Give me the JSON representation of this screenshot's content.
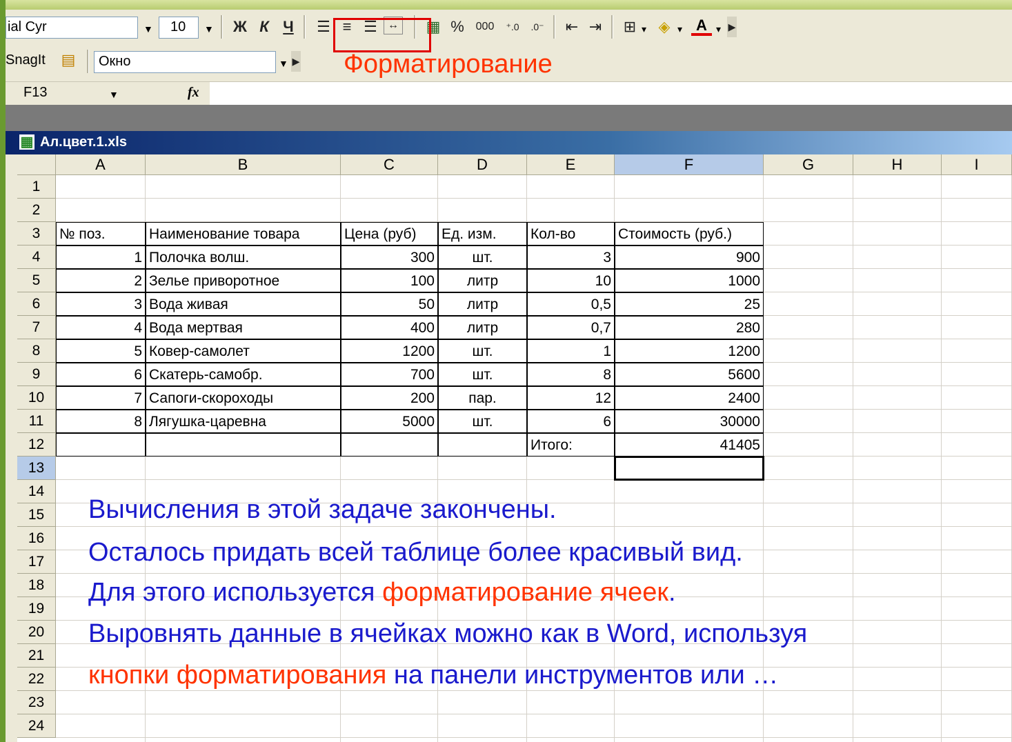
{
  "toolbar": {
    "font_name": "ial Cyr",
    "font_size": "10",
    "bold_label": "Ж",
    "italic_label": "К",
    "underline_label": "Ч",
    "percent_label": "%",
    "thousands_label": "000",
    "snagit_label": "SnagIt",
    "window_label": "Окно",
    "formatting_caption": "Форматирование"
  },
  "formula_bar": {
    "name_box": "F13",
    "fx_label": "fx"
  },
  "window": {
    "title": "Ал.цвет.1.xls"
  },
  "columns": [
    "A",
    "B",
    "C",
    "D",
    "E",
    "F",
    "G",
    "H",
    "I"
  ],
  "selected_column": "F",
  "selected_row": "13",
  "rows": [
    "1",
    "2",
    "3",
    "4",
    "5",
    "6",
    "7",
    "8",
    "9",
    "10",
    "11",
    "12",
    "13",
    "14",
    "15",
    "16",
    "17",
    "18",
    "19",
    "20",
    "21",
    "22",
    "23",
    "24"
  ],
  "table": {
    "headers": [
      "№ поз.",
      "Наименование товара",
      "Цена (руб)",
      "Ед. изм.",
      "Кол-во",
      "Стоимость (руб.)"
    ],
    "items": [
      [
        "1",
        "Полочка волш.",
        "300",
        "шт.",
        "3",
        "900"
      ],
      [
        "2",
        "Зелье приворотное",
        "100",
        "литр",
        "10",
        "1000"
      ],
      [
        "3",
        "Вода живая",
        "50",
        "литр",
        "0,5",
        "25"
      ],
      [
        "4",
        "Вода мертвая",
        "400",
        "литр",
        "0,7",
        "280"
      ],
      [
        "5",
        "Ковер-самолет",
        "1200",
        "шт.",
        "1",
        "1200"
      ],
      [
        "6",
        "Скатерь-самобр.",
        "700",
        "шт.",
        "8",
        "5600"
      ],
      [
        "7",
        "Сапоги-скороходы",
        "200",
        "пар.",
        "12",
        "2400"
      ],
      [
        "8",
        "Лягушка-царевна",
        "5000",
        "шт.",
        "6",
        "30000"
      ]
    ],
    "total_label": "Итого:",
    "total_value": "41405"
  },
  "notes": {
    "line1": "Вычисления в этой задаче закончены.",
    "line2": "Осталось придать всей таблице более красивый вид.",
    "line3a": "Для этого используется ",
    "line3b": "форматирование ячеек",
    "line3c": ".",
    "line4": "Выровнять данные в ячейках можно как в Word, используя",
    "line5a": "кнопки форматирования",
    "line5b": " на панели инструментов или …"
  },
  "colors": {
    "highlight_red": "#e00000",
    "note_blue": "#1a1acc",
    "note_red": "#ff3300"
  }
}
